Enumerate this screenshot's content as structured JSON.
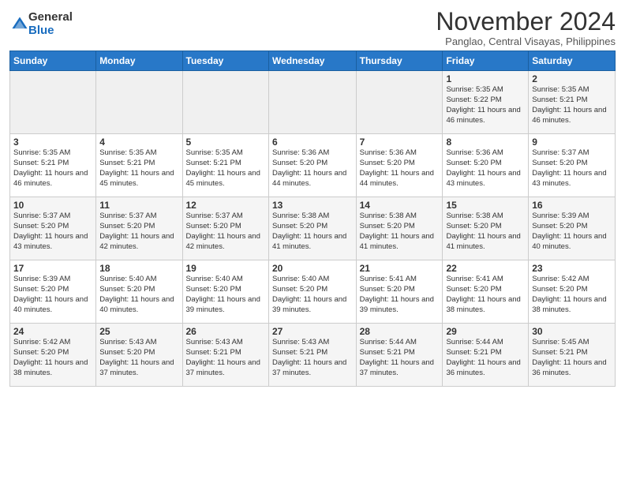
{
  "logo": {
    "general": "General",
    "blue": "Blue"
  },
  "title": "November 2024",
  "location": "Panglao, Central Visayas, Philippines",
  "days_of_week": [
    "Sunday",
    "Monday",
    "Tuesday",
    "Wednesday",
    "Thursday",
    "Friday",
    "Saturday"
  ],
  "weeks": [
    [
      {
        "day": "",
        "info": ""
      },
      {
        "day": "",
        "info": ""
      },
      {
        "day": "",
        "info": ""
      },
      {
        "day": "",
        "info": ""
      },
      {
        "day": "",
        "info": ""
      },
      {
        "day": "1",
        "info": "Sunrise: 5:35 AM\nSunset: 5:22 PM\nDaylight: 11 hours and 46 minutes."
      },
      {
        "day": "2",
        "info": "Sunrise: 5:35 AM\nSunset: 5:21 PM\nDaylight: 11 hours and 46 minutes."
      }
    ],
    [
      {
        "day": "3",
        "info": "Sunrise: 5:35 AM\nSunset: 5:21 PM\nDaylight: 11 hours and 46 minutes."
      },
      {
        "day": "4",
        "info": "Sunrise: 5:35 AM\nSunset: 5:21 PM\nDaylight: 11 hours and 45 minutes."
      },
      {
        "day": "5",
        "info": "Sunrise: 5:35 AM\nSunset: 5:21 PM\nDaylight: 11 hours and 45 minutes."
      },
      {
        "day": "6",
        "info": "Sunrise: 5:36 AM\nSunset: 5:20 PM\nDaylight: 11 hours and 44 minutes."
      },
      {
        "day": "7",
        "info": "Sunrise: 5:36 AM\nSunset: 5:20 PM\nDaylight: 11 hours and 44 minutes."
      },
      {
        "day": "8",
        "info": "Sunrise: 5:36 AM\nSunset: 5:20 PM\nDaylight: 11 hours and 43 minutes."
      },
      {
        "day": "9",
        "info": "Sunrise: 5:37 AM\nSunset: 5:20 PM\nDaylight: 11 hours and 43 minutes."
      }
    ],
    [
      {
        "day": "10",
        "info": "Sunrise: 5:37 AM\nSunset: 5:20 PM\nDaylight: 11 hours and 43 minutes."
      },
      {
        "day": "11",
        "info": "Sunrise: 5:37 AM\nSunset: 5:20 PM\nDaylight: 11 hours and 42 minutes."
      },
      {
        "day": "12",
        "info": "Sunrise: 5:37 AM\nSunset: 5:20 PM\nDaylight: 11 hours and 42 minutes."
      },
      {
        "day": "13",
        "info": "Sunrise: 5:38 AM\nSunset: 5:20 PM\nDaylight: 11 hours and 41 minutes."
      },
      {
        "day": "14",
        "info": "Sunrise: 5:38 AM\nSunset: 5:20 PM\nDaylight: 11 hours and 41 minutes."
      },
      {
        "day": "15",
        "info": "Sunrise: 5:38 AM\nSunset: 5:20 PM\nDaylight: 11 hours and 41 minutes."
      },
      {
        "day": "16",
        "info": "Sunrise: 5:39 AM\nSunset: 5:20 PM\nDaylight: 11 hours and 40 minutes."
      }
    ],
    [
      {
        "day": "17",
        "info": "Sunrise: 5:39 AM\nSunset: 5:20 PM\nDaylight: 11 hours and 40 minutes."
      },
      {
        "day": "18",
        "info": "Sunrise: 5:40 AM\nSunset: 5:20 PM\nDaylight: 11 hours and 40 minutes."
      },
      {
        "day": "19",
        "info": "Sunrise: 5:40 AM\nSunset: 5:20 PM\nDaylight: 11 hours and 39 minutes."
      },
      {
        "day": "20",
        "info": "Sunrise: 5:40 AM\nSunset: 5:20 PM\nDaylight: 11 hours and 39 minutes."
      },
      {
        "day": "21",
        "info": "Sunrise: 5:41 AM\nSunset: 5:20 PM\nDaylight: 11 hours and 39 minutes."
      },
      {
        "day": "22",
        "info": "Sunrise: 5:41 AM\nSunset: 5:20 PM\nDaylight: 11 hours and 38 minutes."
      },
      {
        "day": "23",
        "info": "Sunrise: 5:42 AM\nSunset: 5:20 PM\nDaylight: 11 hours and 38 minutes."
      }
    ],
    [
      {
        "day": "24",
        "info": "Sunrise: 5:42 AM\nSunset: 5:20 PM\nDaylight: 11 hours and 38 minutes."
      },
      {
        "day": "25",
        "info": "Sunrise: 5:43 AM\nSunset: 5:20 PM\nDaylight: 11 hours and 37 minutes."
      },
      {
        "day": "26",
        "info": "Sunrise: 5:43 AM\nSunset: 5:21 PM\nDaylight: 11 hours and 37 minutes."
      },
      {
        "day": "27",
        "info": "Sunrise: 5:43 AM\nSunset: 5:21 PM\nDaylight: 11 hours and 37 minutes."
      },
      {
        "day": "28",
        "info": "Sunrise: 5:44 AM\nSunset: 5:21 PM\nDaylight: 11 hours and 37 minutes."
      },
      {
        "day": "29",
        "info": "Sunrise: 5:44 AM\nSunset: 5:21 PM\nDaylight: 11 hours and 36 minutes."
      },
      {
        "day": "30",
        "info": "Sunrise: 5:45 AM\nSunset: 5:21 PM\nDaylight: 11 hours and 36 minutes."
      }
    ]
  ]
}
